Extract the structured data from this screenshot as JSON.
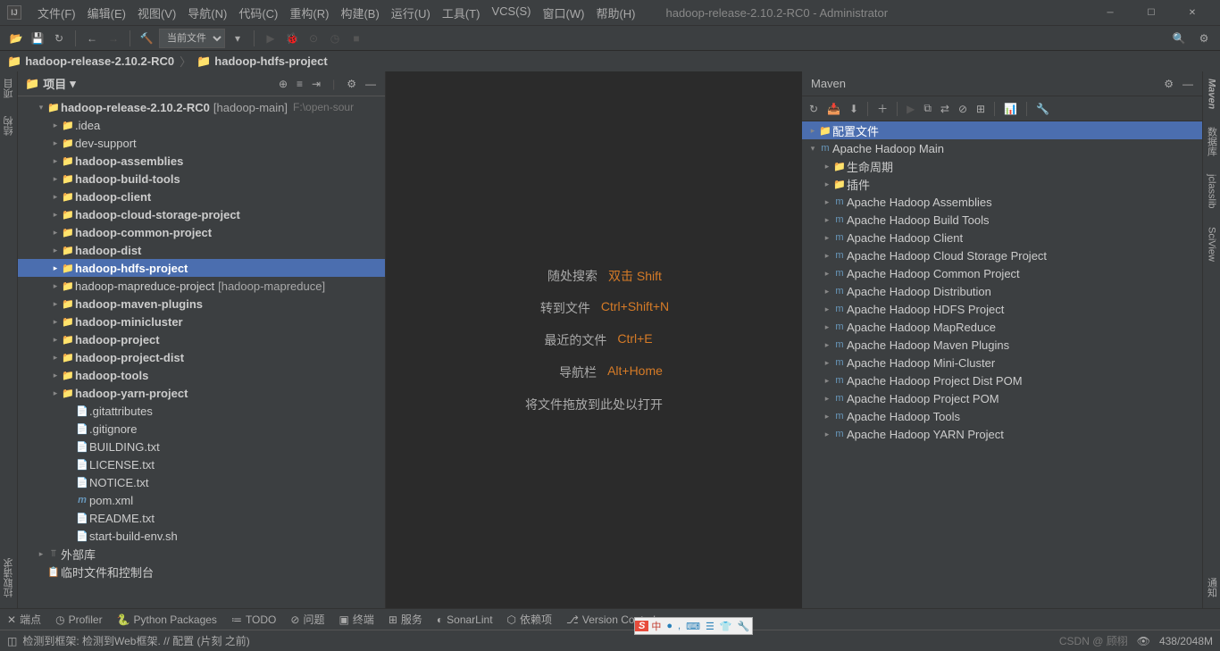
{
  "window": {
    "title": "hadoop-release-2.10.2-RC0 - Administrator"
  },
  "menu": [
    "文件(F)",
    "编辑(E)",
    "视图(V)",
    "导航(N)",
    "代码(C)",
    "重构(R)",
    "构建(B)",
    "运行(U)",
    "工具(T)",
    "VCS(S)",
    "窗口(W)",
    "帮助(H)"
  ],
  "toolbar": {
    "config": "当前文件"
  },
  "breadcrumb": {
    "root": "hadoop-release-2.10.2-RC0",
    "child": "hadoop-hdfs-project"
  },
  "left_tabs": [
    "项目",
    "结构",
    "拉取请求"
  ],
  "project": {
    "tab": "项目",
    "root": {
      "name": "hadoop-release-2.10.2-RC0",
      "tag": "[hadoop-main]",
      "path": "F:\\open-sour"
    },
    "children1": [
      ".idea",
      "dev-support",
      "hadoop-assemblies",
      "hadoop-build-tools",
      "hadoop-client",
      "hadoop-cloud-storage-project",
      "hadoop-common-project",
      "hadoop-dist",
      "hadoop-hdfs-project"
    ],
    "mapreduce": {
      "name": "hadoop-mapreduce-project",
      "tag": "[hadoop-mapreduce]"
    },
    "children2": [
      "hadoop-maven-plugins",
      "hadoop-minicluster",
      "hadoop-project",
      "hadoop-project-dist",
      "hadoop-tools",
      "hadoop-yarn-project"
    ],
    "files": [
      ".gitattributes",
      ".gitignore",
      "BUILDING.txt",
      "LICENSE.txt",
      "NOTICE.txt",
      "pom.xml",
      "README.txt",
      "start-build-env.sh"
    ],
    "external": "外部库",
    "scratch": "临时文件和控制台"
  },
  "editor_hints": [
    {
      "label": "随处搜索",
      "key": "双击 Shift"
    },
    {
      "label": "转到文件",
      "key": "Ctrl+Shift+N"
    },
    {
      "label": "最近的文件",
      "key": "Ctrl+E"
    },
    {
      "label": "导航栏",
      "key": "Alt+Home"
    }
  ],
  "editor_note": "将文件拖放到此处以打开",
  "maven": {
    "title": "Maven",
    "profiles": "配置文件",
    "main": "Apache Hadoop Main",
    "lifecycle": "生命周期",
    "plugins": "插件",
    "modules": [
      "Apache Hadoop Assemblies",
      "Apache Hadoop Build Tools",
      "Apache Hadoop Client",
      "Apache Hadoop Cloud Storage Project",
      "Apache Hadoop Common Project",
      "Apache Hadoop Distribution",
      "Apache Hadoop HDFS Project",
      "Apache Hadoop MapReduce",
      "Apache Hadoop Maven Plugins",
      "Apache Hadoop Mini-Cluster",
      "Apache Hadoop Project Dist POM",
      "Apache Hadoop Project POM",
      "Apache Hadoop Tools",
      "Apache Hadoop YARN Project"
    ]
  },
  "right_tabs": [
    "Maven",
    "数据库",
    "jclasslib",
    "SciView",
    "通知"
  ],
  "bottom_tabs": [
    "端点",
    "Profiler",
    "Python Packages",
    "TODO",
    "问题",
    "终端",
    "服务",
    "SonarLint",
    "依赖项",
    "Version Control"
  ],
  "status": {
    "msg": "检测到框架: 检测到Web框架. // 配置 (片刻 之前)",
    "mem": "438/2048M",
    "watermark": "CSDN @ 顾栩"
  },
  "ime": [
    "中",
    "●",
    ",",
    "⌨",
    "☰",
    "👕",
    "🔧"
  ]
}
